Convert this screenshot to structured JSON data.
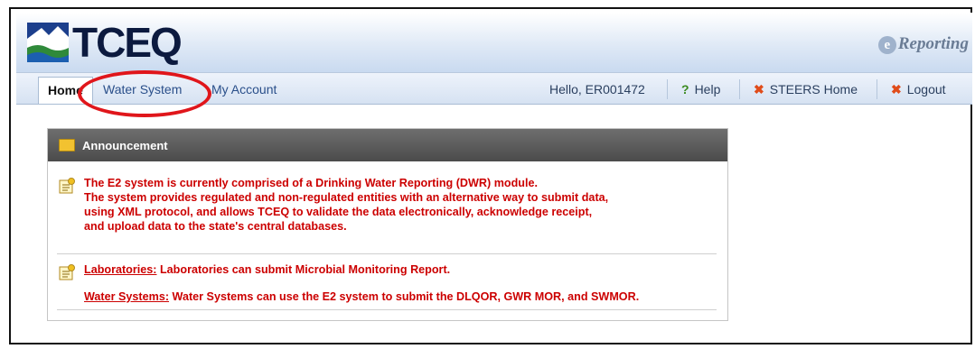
{
  "header": {
    "logo_text": "TCEQ",
    "brand_text": "Reporting"
  },
  "nav": {
    "tabs": [
      {
        "label": "Home",
        "active": true
      },
      {
        "label": "Water System",
        "active": false
      },
      {
        "label": "My Account",
        "active": false
      }
    ],
    "greeting": "Hello, ER001472",
    "help_label": "Help",
    "steers_home_label": "STEERS Home",
    "logout_label": "Logout"
  },
  "announcement": {
    "title": "Announcement",
    "intro_lines": [
      "The E2 system is currently comprised of a Drinking Water Reporting (DWR) module.",
      "The system provides regulated and non-regulated entities with an alternative way to submit data,",
      "using XML protocol, and allows TCEQ to validate the data electronically, acknowledge receipt,",
      "and upload data to the state's central databases."
    ],
    "items": [
      {
        "link": "Laboratories:",
        "text": " Laboratories can submit Microbial Monitoring Report."
      },
      {
        "link": "Water Systems:",
        "text": " Water Systems can use the E2 system to submit the DLQOR, GWR MOR, and SWMOR."
      }
    ]
  },
  "colors": {
    "highlight_circle": "#e0161b",
    "message_text": "#cc0000",
    "panel_header": "#555555"
  }
}
